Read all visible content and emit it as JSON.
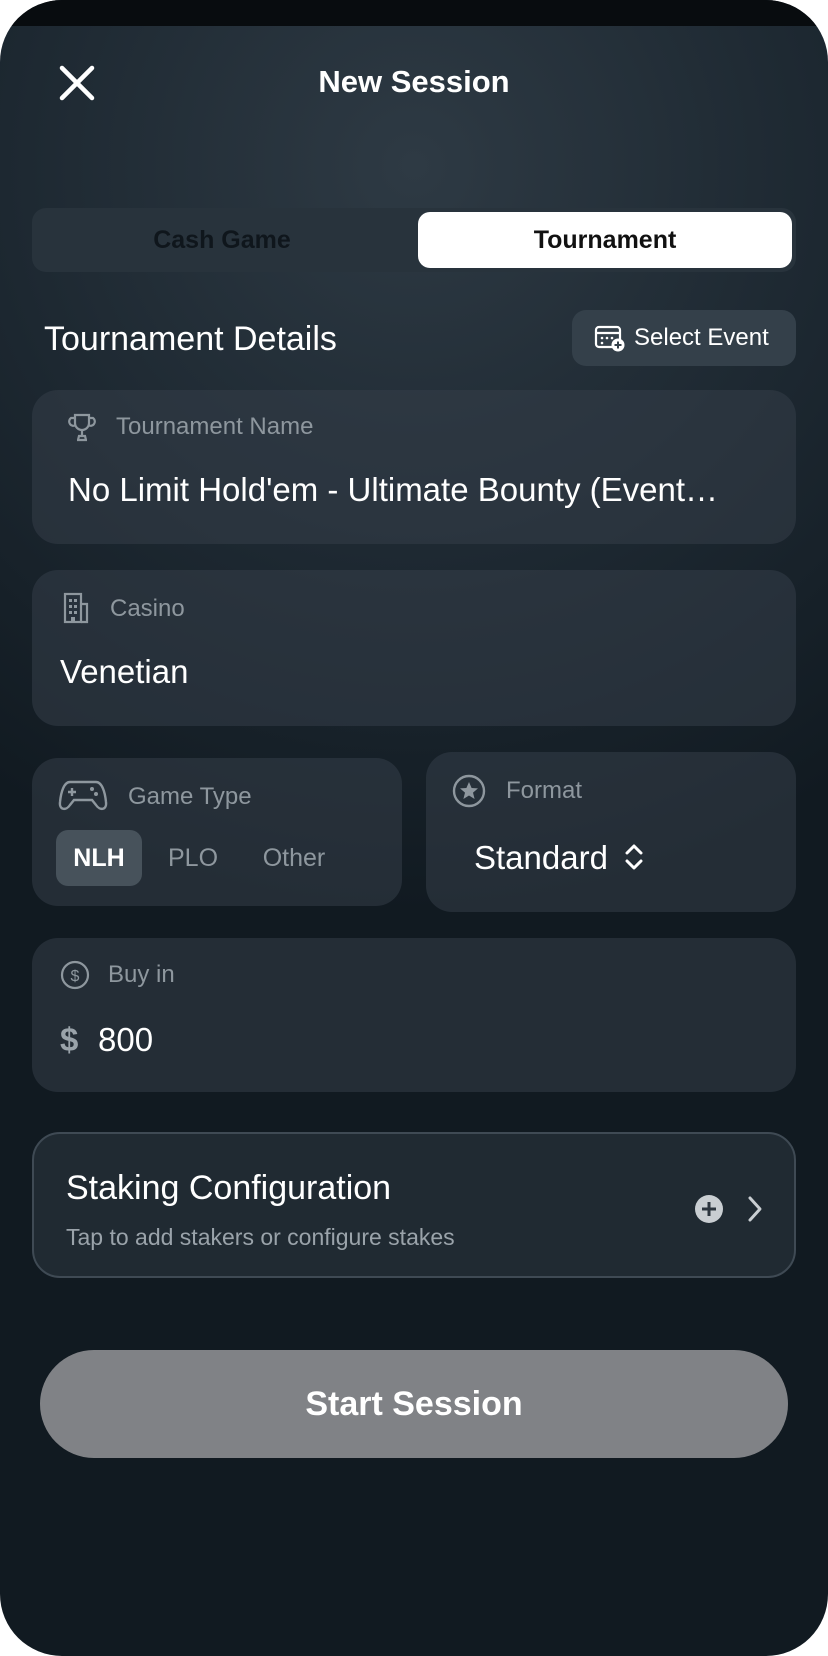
{
  "header": {
    "title": "New Session"
  },
  "tabs": [
    {
      "label": "Cash Game",
      "selected": false
    },
    {
      "label": "Tournament",
      "selected": true
    }
  ],
  "section": {
    "title": "Tournament Details",
    "select_event_label": "Select Event"
  },
  "tournament_name": {
    "label": "Tournament Name",
    "value": "No Limit Hold'em - Ultimate Bounty (Event…"
  },
  "casino": {
    "label": "Casino",
    "value": "Venetian"
  },
  "game_type": {
    "label": "Game Type",
    "options": [
      {
        "label": "NLH",
        "selected": true
      },
      {
        "label": "PLO",
        "selected": false
      },
      {
        "label": "Other",
        "selected": false
      }
    ]
  },
  "format": {
    "label": "Format",
    "value": "Standard"
  },
  "buy_in": {
    "label": "Buy in",
    "currency_symbol": "$",
    "value": "800"
  },
  "staking": {
    "title": "Staking Configuration",
    "subtitle": "Tap to add stakers or configure stakes"
  },
  "start_button": {
    "label": "Start Session"
  },
  "colors": {
    "background": "#1d2831",
    "card": "#2c3640",
    "button_disabled": "#808286",
    "accent_text": "#ffffff"
  },
  "icons": [
    "close-icon",
    "calendar-add-icon",
    "trophy-icon",
    "building-icon",
    "gamepad-icon",
    "star-icon",
    "dollar-icon",
    "plus-circle-icon",
    "chevron-right-icon",
    "up-down-chevron-icon"
  ]
}
